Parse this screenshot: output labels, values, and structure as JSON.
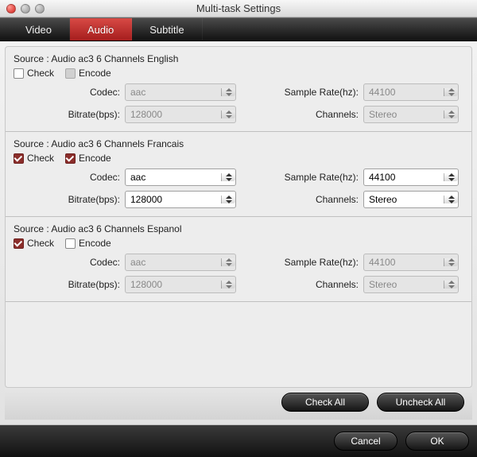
{
  "window": {
    "title": "Multi-task Settings"
  },
  "tabs": [
    {
      "label": "Video",
      "active": false
    },
    {
      "label": "Audio",
      "active": true
    },
    {
      "label": "Subtitle",
      "active": false
    }
  ],
  "labels": {
    "source_prefix": "Source :",
    "check": "Check",
    "encode": "Encode",
    "codec": "Codec:",
    "bitrate": "Bitrate(bps):",
    "sample_rate": "Sample Rate(hz):",
    "channels": "Channels:"
  },
  "tracks": [
    {
      "source": "Audio  ac3  6 Channels  English",
      "check": false,
      "encode": false,
      "encode_disabled": true,
      "enabled": false,
      "codec": "aac",
      "bitrate": "128000",
      "sample_rate": "44100",
      "channels": "Stereo"
    },
    {
      "source": "Audio  ac3  6 Channels  Francais",
      "check": true,
      "encode": true,
      "encode_disabled": false,
      "enabled": true,
      "codec": "aac",
      "bitrate": "128000",
      "sample_rate": "44100",
      "channels": "Stereo"
    },
    {
      "source": "Audio  ac3  6 Channels  Espanol",
      "check": true,
      "encode": false,
      "encode_disabled": false,
      "enabled": false,
      "codec": "aac",
      "bitrate": "128000",
      "sample_rate": "44100",
      "channels": "Stereo"
    }
  ],
  "buttons": {
    "check_all": "Check All",
    "uncheck_all": "Uncheck All",
    "cancel": "Cancel",
    "ok": "OK"
  }
}
